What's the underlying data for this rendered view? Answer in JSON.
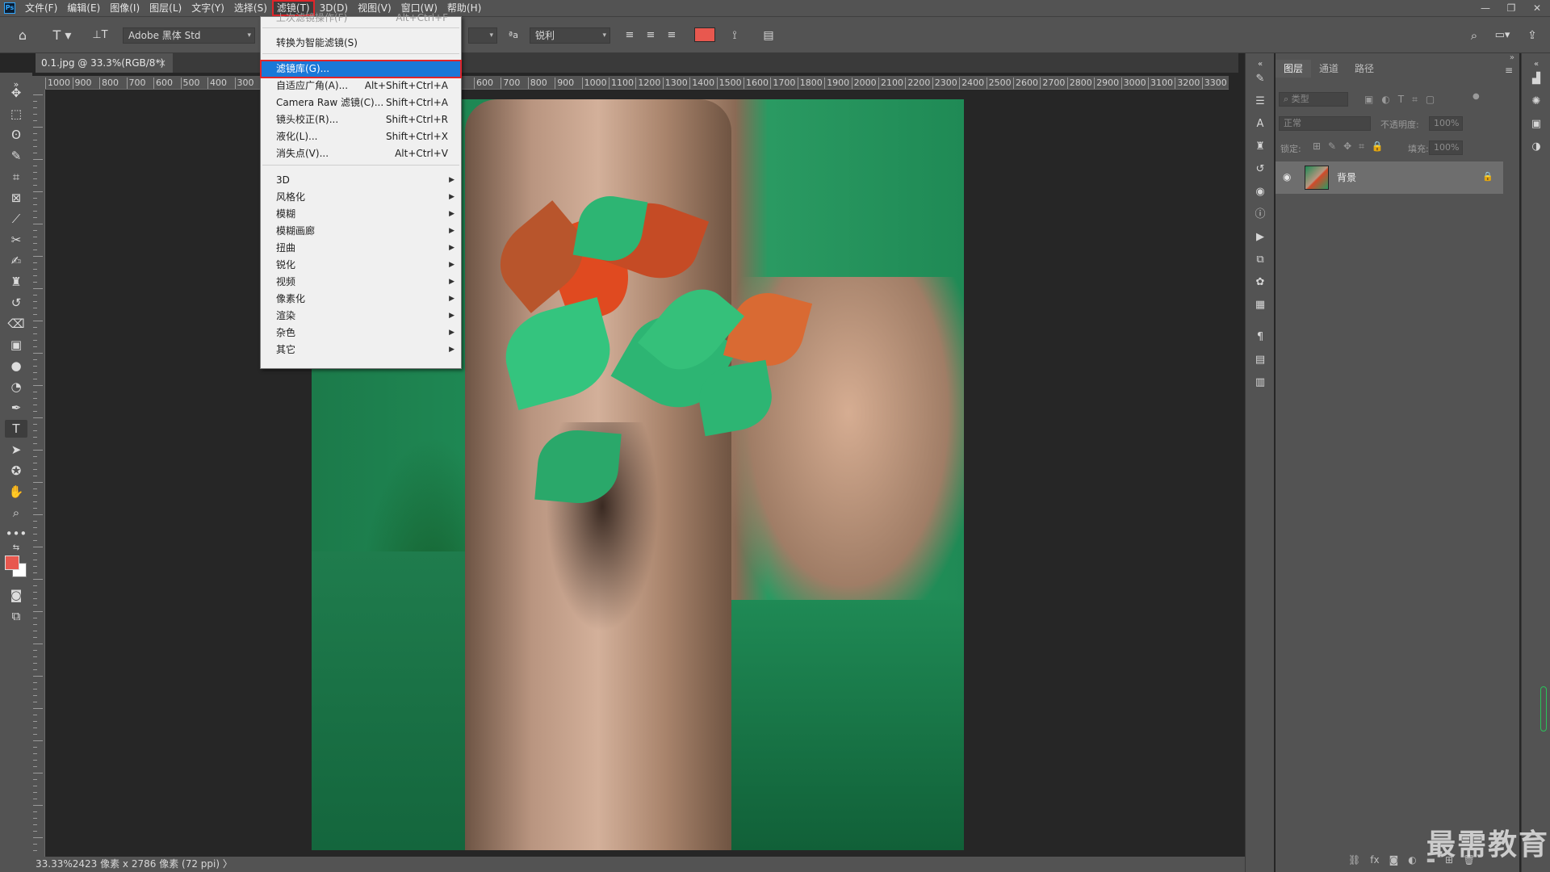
{
  "menubar": {
    "logo": "Ps",
    "items": [
      "文件(F)",
      "编辑(E)",
      "图像(I)",
      "图层(L)",
      "文字(Y)",
      "选择(S)",
      "滤镜(T)",
      "3D(D)",
      "视图(V)",
      "窗口(W)",
      "帮助(H)"
    ],
    "active_index": 6,
    "window_controls": [
      "—",
      "❐",
      "✕"
    ]
  },
  "options_bar": {
    "font_family": "Adobe 黑体 Std",
    "antialias_label": "ªa",
    "antialias_value": "锐利",
    "text_color": "#e8584f"
  },
  "document_tab": {
    "title": "0.1.jpg @ 33.3%(RGB/8*)",
    "close": "×"
  },
  "ruler": {
    "left_labels": [
      "1000",
      "900",
      "800",
      "700",
      "600",
      "500",
      "400",
      "300"
    ],
    "right_labels": [
      "600",
      "700",
      "800",
      "900",
      "1000",
      "1100",
      "1200",
      "1300",
      "1400",
      "1500",
      "1600",
      "1700",
      "1800",
      "1900",
      "2000",
      "2100",
      "2200",
      "2300",
      "2400",
      "2500",
      "2600",
      "2700",
      "2800",
      "2900",
      "3000",
      "3100",
      "3200",
      "3300"
    ]
  },
  "filter_menu": {
    "items": [
      {
        "label": "上次滤镜操作(F)",
        "shortcut": "Alt+Ctrl+F",
        "disabled": true
      },
      {
        "label": "转换为智能滤镜(S)",
        "shortcut": ""
      },
      {
        "label": "滤镜库(G)...",
        "shortcut": "",
        "highlighted": true
      },
      {
        "label": "自适应广角(A)...",
        "shortcut": "Alt+Shift+Ctrl+A"
      },
      {
        "label": "Camera Raw 滤镜(C)...",
        "shortcut": "Shift+Ctrl+A"
      },
      {
        "label": "镜头校正(R)...",
        "shortcut": "Shift+Ctrl+R"
      },
      {
        "label": "液化(L)...",
        "shortcut": "Shift+Ctrl+X"
      },
      {
        "label": "消失点(V)...",
        "shortcut": "Alt+Ctrl+V"
      },
      {
        "label": "3D",
        "submenu": true
      },
      {
        "label": "风格化",
        "submenu": true
      },
      {
        "label": "模糊",
        "submenu": true
      },
      {
        "label": "模糊画廊",
        "submenu": true
      },
      {
        "label": "扭曲",
        "submenu": true
      },
      {
        "label": "锐化",
        "submenu": true
      },
      {
        "label": "视频",
        "submenu": true
      },
      {
        "label": "像素化",
        "submenu": true
      },
      {
        "label": "渲染",
        "submenu": true
      },
      {
        "label": "杂色",
        "submenu": true
      },
      {
        "label": "其它",
        "submenu": true
      }
    ]
  },
  "layers_panel": {
    "tabs": [
      "图层",
      "通道",
      "路径"
    ],
    "active_tab": 0,
    "filter_kind": "类型",
    "blend_mode": "正常",
    "opacity_label": "不透明度:",
    "opacity_value": "100%",
    "lock_label": "锁定:",
    "fill_label": "填充:",
    "fill_value": "100%",
    "layers": [
      {
        "name": "背景",
        "visible": true,
        "locked": true
      }
    ],
    "footer_icons": [
      "link-icon",
      "fx-icon",
      "mask-icon",
      "adjustment-icon",
      "folder-icon",
      "new-layer-icon",
      "trash-icon"
    ]
  },
  "status_bar": {
    "zoom": "33.33%",
    "doc_info": "2423 像素 x 2786 像素 (72 ppi)",
    "arrow": "〉"
  },
  "watermark": "最需教育",
  "colors": {
    "foreground": "#e8584f",
    "background": "#ffffff",
    "menu_highlight": "#1a78d8",
    "outline_red": "#e0252a"
  }
}
